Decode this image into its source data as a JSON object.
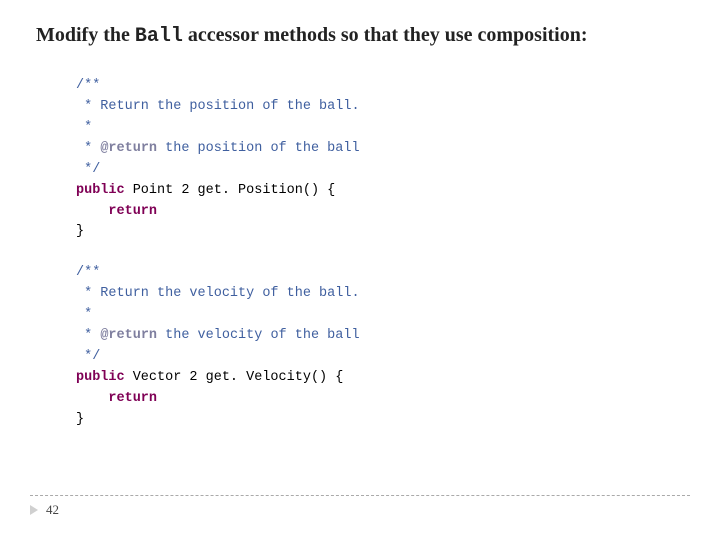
{
  "heading": {
    "prefix": "Modify the ",
    "mono": "Ball",
    "suffix": " accessor methods so that they use composition:"
  },
  "code": {
    "block1": {
      "l1": "/**",
      "l2": " * Return the position of the ball.",
      "l3": " *",
      "l4a": " * ",
      "l4tag": "@return",
      "l4b": " the position of the ball",
      "l5": " */",
      "kw_public": "public",
      "type1": " Point 2 ",
      "method1": "get. Position() {",
      "kw_return": "return",
      "close": "}"
    },
    "block2": {
      "l1": "/**",
      "l2": " * Return the velocity of the ball.",
      "l3": " *",
      "l4a": " * ",
      "l4tag": "@return",
      "l4b": " the velocity of the ball",
      "l5": " */",
      "kw_public": "public",
      "type2": " Vector 2 ",
      "method2": "get. Velocity() {",
      "kw_return": "return",
      "close": "}"
    }
  },
  "page_number": "42"
}
